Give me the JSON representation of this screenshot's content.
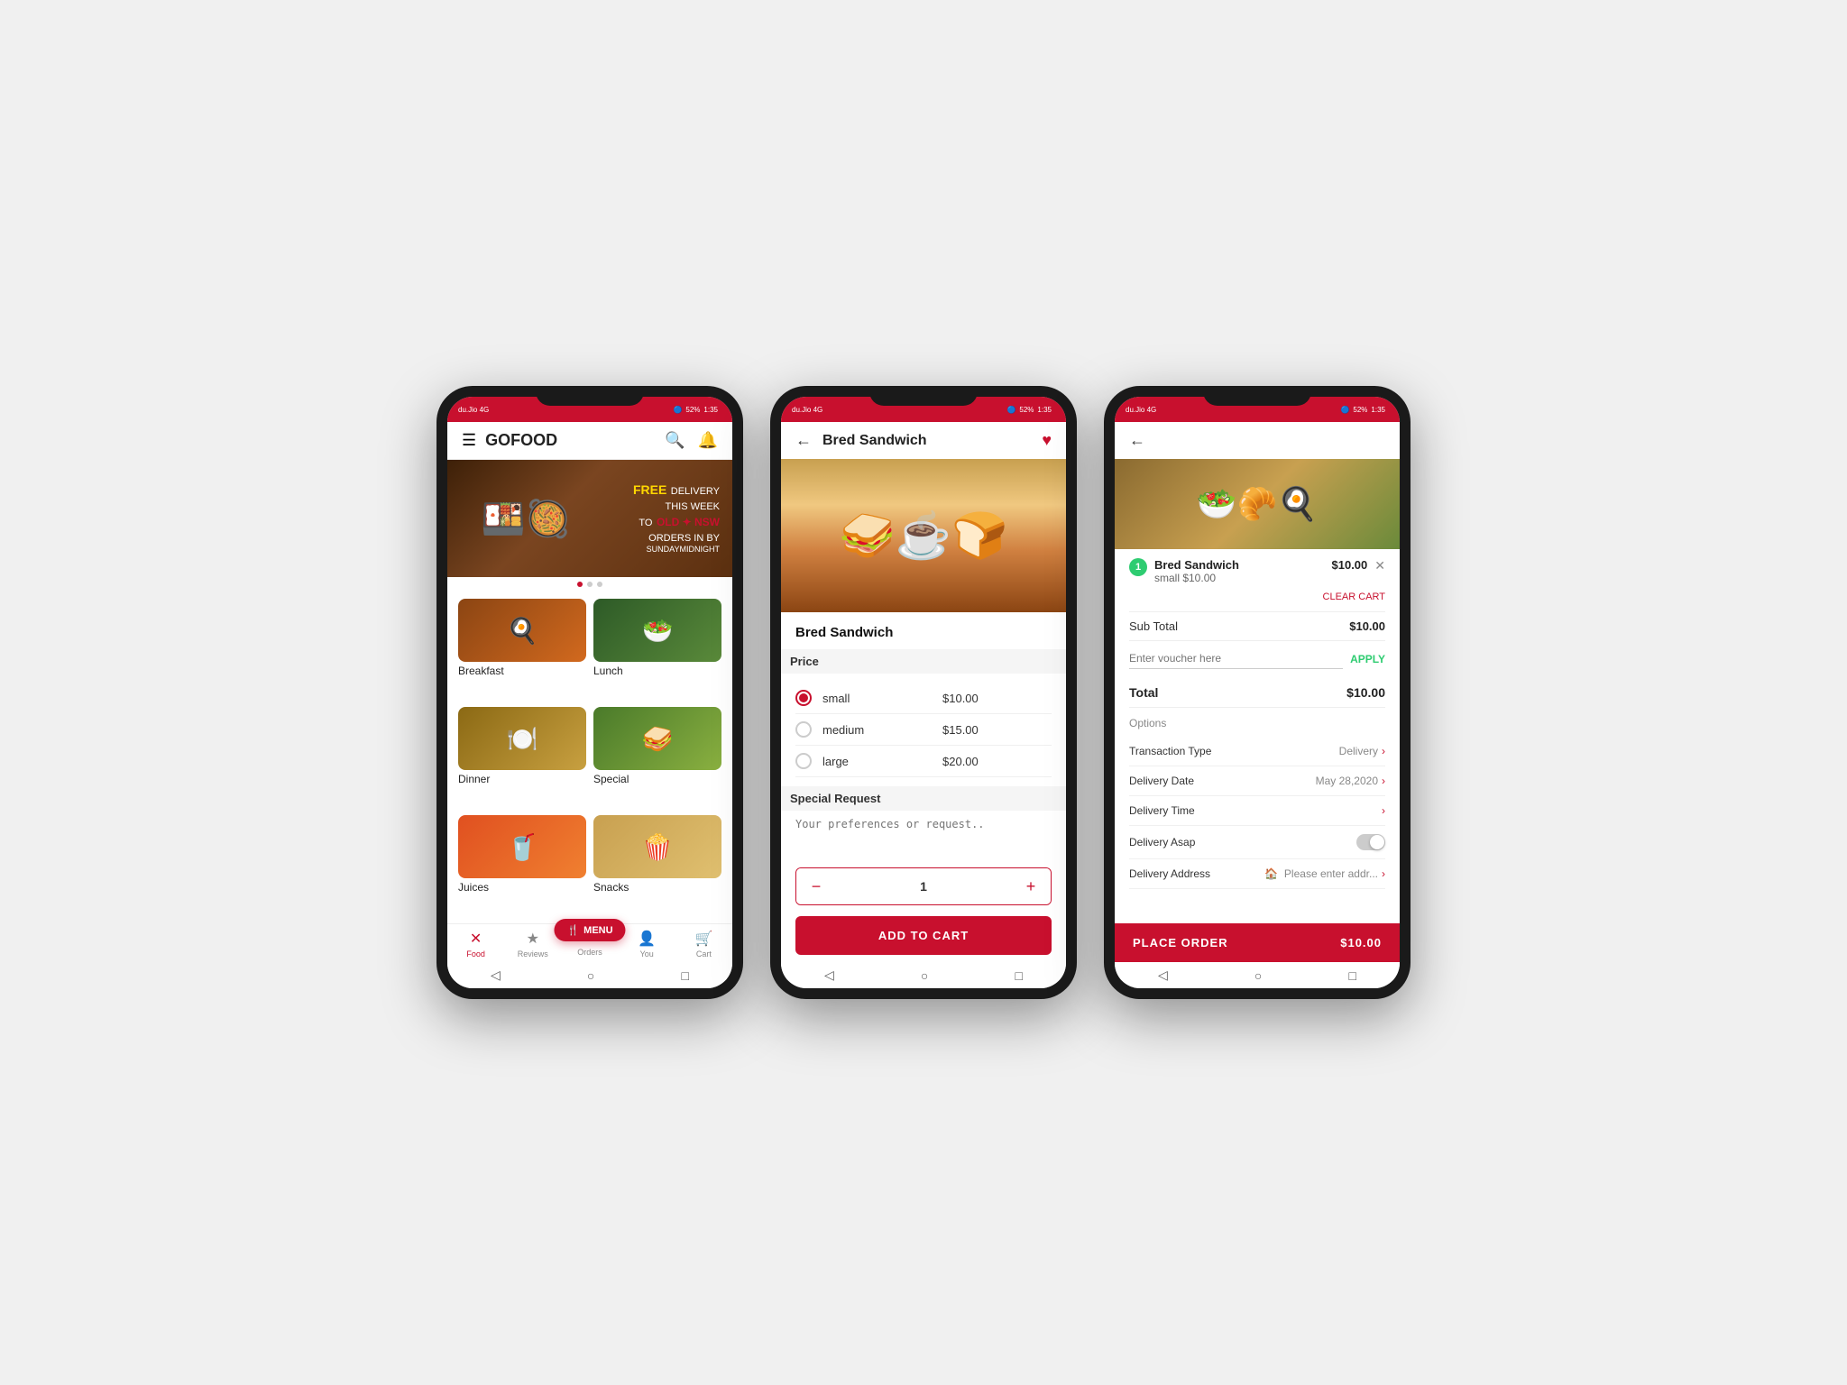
{
  "app": {
    "title": "GOFOOD",
    "time": "1:35",
    "battery": "52%",
    "signal": "4G"
  },
  "phone1": {
    "statusBar": {
      "left": "du.Jio 4G",
      "battery": "52%",
      "time": "1:35"
    },
    "header": {
      "title": "GOFOOD",
      "searchIcon": "🔍",
      "bellIcon": "🔔"
    },
    "banner": {
      "free": "FREE",
      "line1": "DELIVERY",
      "line2": "THIS WEEK",
      "line3": "TO",
      "highlight": "OLD ✦ NSW",
      "line4": "ORDERS IN BY",
      "footer": "SUNDAYMIDNIGHT"
    },
    "categories": [
      {
        "id": "breakfast",
        "label": "Breakfast",
        "emoji": "🍳"
      },
      {
        "id": "lunch",
        "label": "Lunch",
        "emoji": "🥗"
      },
      {
        "id": "dinner",
        "label": "Dinner",
        "emoji": "🍽️"
      },
      {
        "id": "special",
        "label": "Special",
        "emoji": "🥪"
      },
      {
        "id": "juices",
        "label": "Juices",
        "emoji": "🥤"
      },
      {
        "id": "snacks",
        "label": "Snacks",
        "emoji": "🍿"
      }
    ],
    "menuFab": "MENU",
    "navItems": [
      {
        "id": "food",
        "label": "Food",
        "icon": "✕",
        "active": true
      },
      {
        "id": "reviews",
        "label": "Reviews",
        "icon": "★"
      },
      {
        "id": "orders",
        "label": "Orders",
        "icon": "≡"
      },
      {
        "id": "you",
        "label": "You",
        "icon": "👤"
      },
      {
        "id": "cart",
        "label": "Cart",
        "icon": "🛒"
      }
    ]
  },
  "phone2": {
    "statusBar": {
      "left": "du.Jio 4G",
      "battery": "52%",
      "time": "1:35"
    },
    "header": {
      "backIcon": "←",
      "title": "Bred Sandwich",
      "heartIcon": "♥"
    },
    "foodName": "Bred Sandwich",
    "priceLabel": "Price",
    "priceOptions": [
      {
        "id": "small",
        "label": "small",
        "price": "$10.00",
        "selected": true
      },
      {
        "id": "medium",
        "label": "medium",
        "price": "$15.00",
        "selected": false
      },
      {
        "id": "large",
        "label": "large",
        "price": "$20.00",
        "selected": false
      }
    ],
    "specialRequestLabel": "Special Request",
    "specialRequestPlaceholder": "Your preferences or request..",
    "quantity": "1",
    "addToCart": "ADD TO CART",
    "decrementIcon": "−",
    "incrementIcon": "+"
  },
  "phone3": {
    "statusBar": {
      "left": "du.Jio 4G",
      "battery": "52%",
      "time": "1:35"
    },
    "header": {
      "backIcon": "←"
    },
    "cartItem": {
      "badge": "1",
      "name": "Bred Sandwich",
      "subLabel": "small $10.00",
      "price": "$10.00"
    },
    "clearCart": "CLEAR CART",
    "subTotalLabel": "Sub Total",
    "subTotalValue": "$10.00",
    "voucherPlaceholder": "Enter voucher here",
    "applyLabel": "APPLY",
    "totalLabel": "Total",
    "totalValue": "$10.00",
    "optionsLabel": "Options",
    "options": [
      {
        "id": "transactionType",
        "label": "Transaction Type",
        "value": "Delivery",
        "hasChevron": true
      },
      {
        "id": "deliveryDate",
        "label": "Delivery Date",
        "value": "May 28,2020",
        "hasChevron": true
      },
      {
        "id": "deliveryTime",
        "label": "Delivery Time",
        "value": "",
        "hasChevron": true
      },
      {
        "id": "deliveryAsap",
        "label": "Delivery Asap",
        "value": "",
        "isToggle": true
      },
      {
        "id": "deliveryAddress",
        "label": "Delivery Address",
        "value": "Please enter addr...",
        "hasChevron": true,
        "hasHomeIcon": true
      }
    ],
    "placeOrderLabel": "PLACE ORDER",
    "placeOrderPrice": "$10.00"
  }
}
